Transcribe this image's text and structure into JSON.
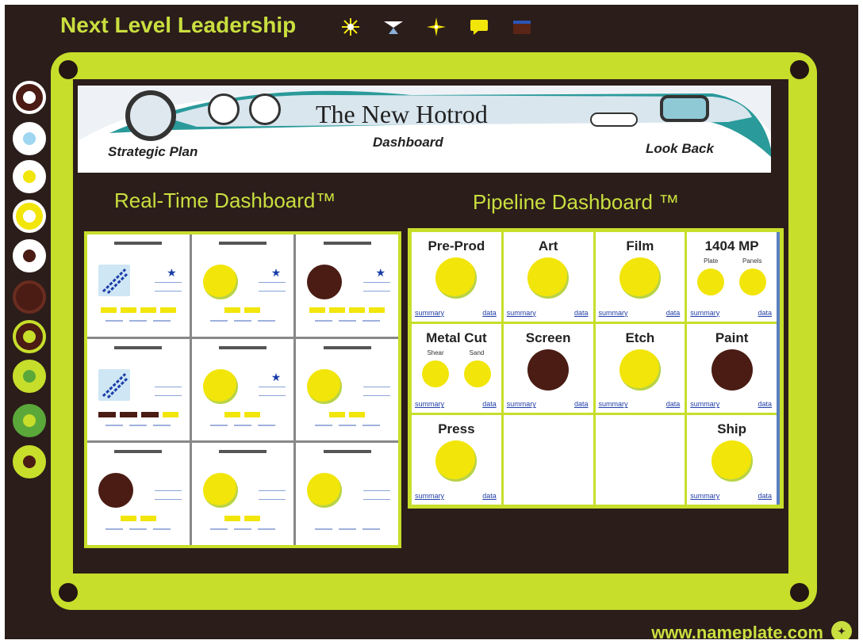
{
  "app": {
    "title": "Next Level Leadership",
    "footer_url": "www.nameplate.com"
  },
  "toolbar": {
    "icons": [
      "sun-icon",
      "bow-icon",
      "sparkle-icon",
      "chat-icon",
      "window-icon"
    ]
  },
  "banner": {
    "title": "The New Hotrod",
    "left_label": "Strategic Plan",
    "center_label": "Dashboard",
    "right_label": "Look Back"
  },
  "realtime": {
    "heading": "Real-Time Dashboard™",
    "cells": [
      {
        "indicator": "arrow",
        "star": true,
        "tags": 4,
        "dark_tags": 0
      },
      {
        "indicator": "yellow",
        "star": true,
        "tags": 2,
        "dark_tags": 0
      },
      {
        "indicator": "brown",
        "star": true,
        "tags": 4,
        "dark_tags": 0
      },
      {
        "indicator": "arrow",
        "star": false,
        "tags": 1,
        "dark_tags": 3
      },
      {
        "indicator": "yellow",
        "star": true,
        "tags": 2,
        "dark_tags": 0
      },
      {
        "indicator": "yellow",
        "star": false,
        "tags": 2,
        "dark_tags": 0
      },
      {
        "indicator": "brown",
        "star": false,
        "tags": 2,
        "dark_tags": 0
      },
      {
        "indicator": "yellow",
        "star": false,
        "tags": 2,
        "dark_tags": 0
      },
      {
        "indicator": "yellow",
        "star": false,
        "tags": 0,
        "dark_tags": 0
      }
    ]
  },
  "pipeline": {
    "heading": "Pipeline Dashboard ™",
    "cells": [
      {
        "label": "Pre-Prod",
        "status": "yellow",
        "summary": "summary",
        "data": "data"
      },
      {
        "label": "Art",
        "status": "yellow",
        "summary": "summary",
        "data": "data"
      },
      {
        "label": "Film",
        "status": "yellow",
        "summary": "summary",
        "data": "data"
      },
      {
        "label": "1404 MP",
        "status": "yellow",
        "summary": "summary",
        "data": "data",
        "split": [
          "Plate",
          "Panels"
        ]
      },
      {
        "label": "Metal Cut",
        "status": "yellow",
        "summary": "summary",
        "data": "data",
        "split": [
          "Shear",
          "Sand"
        ]
      },
      {
        "label": "Screen",
        "status": "brown",
        "summary": "summary",
        "data": "data"
      },
      {
        "label": "Etch",
        "status": "yellow",
        "summary": "summary",
        "data": "data"
      },
      {
        "label": "Paint",
        "status": "brown",
        "summary": "summary",
        "data": "data"
      },
      {
        "label": "Press",
        "status": "yellow",
        "summary": "summary",
        "data": "data"
      },
      {
        "label": "",
        "status": "empty"
      },
      {
        "label": "",
        "status": "empty"
      },
      {
        "label": "Ship",
        "status": "yellow",
        "summary": "summary",
        "data": "data"
      }
    ]
  },
  "side_nav": [
    {
      "ring": "#4a1c14",
      "border": "#ffffff",
      "inner": "#ffffff"
    },
    {
      "ring": "#ffffff",
      "border": "#ffffff",
      "inner": "#9fd6f0"
    },
    {
      "ring": "#ffffff",
      "border": "#ffffff",
      "inner": "#f2e50a"
    },
    {
      "ring": "#f2e50a",
      "border": "#ffffff",
      "inner": "#ffffff"
    },
    {
      "ring": "#ffffff",
      "border": "#ffffff",
      "inner": "#4a1c14"
    },
    {
      "ring": "#4a1c14",
      "border": "#6a2c20",
      "inner": "#4a1c14"
    },
    {
      "ring": "#4a1c14",
      "border": "#c7de2b",
      "inner": "#c7de2b"
    },
    {
      "ring": "#c7de2b",
      "border": "#c7de2b",
      "inner": "#5aa83a"
    },
    {
      "ring": "#5aa83a",
      "border": "#5aa83a",
      "inner": "#c7de2b"
    },
    {
      "ring": "#c7de2b",
      "border": "#c7de2b",
      "inner": "#4a1c14"
    }
  ],
  "colors": {
    "accent": "#c9df3f",
    "frame": "#c7de2b",
    "background": "#2b1d1a",
    "status_good": "#f2e50a",
    "status_bad": "#4a1c14"
  }
}
